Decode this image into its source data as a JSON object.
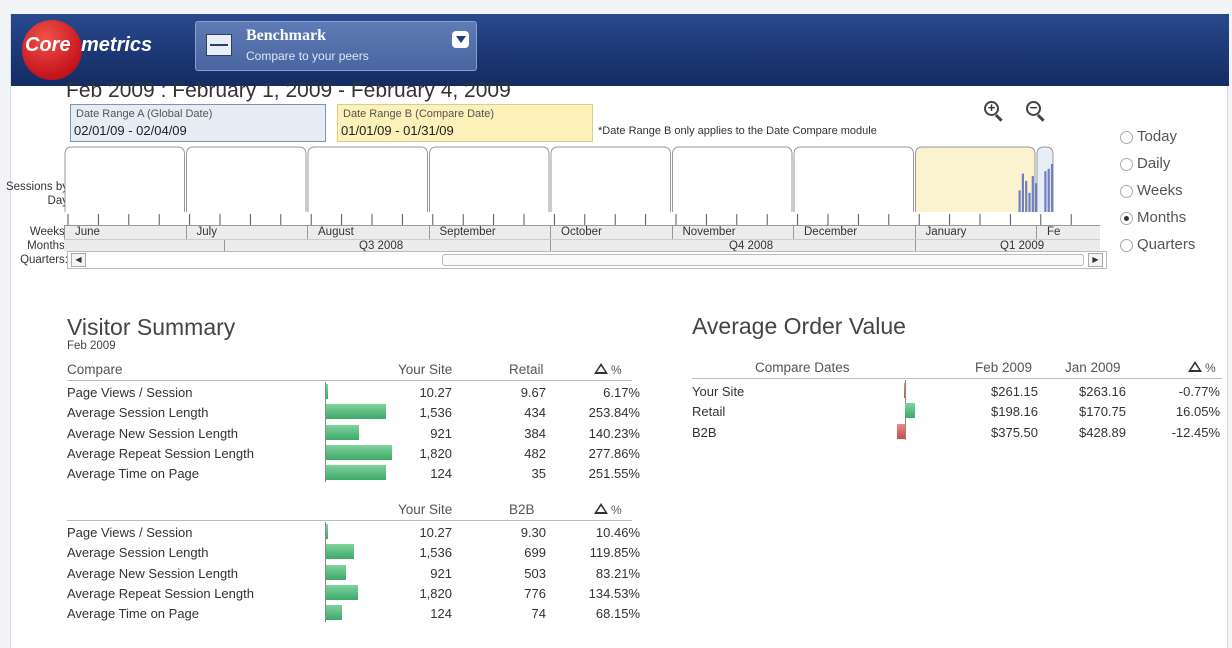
{
  "brand": {
    "core": "Core",
    "metrics": "metrics"
  },
  "report": {
    "title": "Benchmark",
    "subtitle": "Compare to your peers"
  },
  "date_header": "Feb 2009 : February 1, 2009 - February 4, 2009",
  "range_a": {
    "label": "Date Range A (Global Date)",
    "value": "02/01/09 - 02/04/09"
  },
  "range_b": {
    "label": "Date Range B (Compare Date)",
    "value": "01/01/09 - 01/31/09"
  },
  "range_note": "*Date Range B only applies to the Date Compare module",
  "granularity": {
    "options": [
      "Today",
      "Daily",
      "Weeks",
      "Months",
      "Quarters"
    ],
    "selected": "Months"
  },
  "timeline": {
    "row_labels": {
      "sessions": "Sessions by Day",
      "weeks": "Weeks:",
      "months": "Months:",
      "quarters": "Quarters:"
    },
    "months": [
      "June",
      "July",
      "August",
      "September",
      "October",
      "November",
      "December",
      "January",
      "Fe"
    ],
    "quarters": [
      "Q3 2008",
      "Q4 2008",
      "Q1 2009"
    ],
    "sessions_spark": [
      0.45,
      0.8,
      0.65,
      0.4,
      0.75,
      0.6,
      0.85,
      0.9,
      1.0
    ]
  },
  "visitor_summary": {
    "title": "Visitor Summary",
    "period": "Feb 2009",
    "delta_unit": "%",
    "table1": {
      "headers": [
        "Compare",
        "Your Site",
        "Retail"
      ],
      "rows": [
        {
          "metric": "Page Views / Session",
          "your_site": "10.27",
          "peer": "9.67",
          "delta": "6.17%",
          "bar": 6.17
        },
        {
          "metric": "Average Session Length",
          "your_site": "1,536",
          "peer": "434",
          "delta": "253.84%",
          "bar": 253.84
        },
        {
          "metric": "Average New Session Length",
          "your_site": "921",
          "peer": "384",
          "delta": "140.23%",
          "bar": 140.23
        },
        {
          "metric": "Average Repeat Session Length",
          "your_site": "1,820",
          "peer": "482",
          "delta": "277.86%",
          "bar": 277.86
        },
        {
          "metric": "Average Time on Page",
          "your_site": "124",
          "peer": "35",
          "delta": "251.55%",
          "bar": 251.55
        }
      ]
    },
    "table2": {
      "headers": [
        "",
        "Your Site",
        "B2B"
      ],
      "rows": [
        {
          "metric": "Page Views / Session",
          "your_site": "10.27",
          "peer": "9.30",
          "delta": "10.46%",
          "bar": 10.46
        },
        {
          "metric": "Average Session Length",
          "your_site": "1,536",
          "peer": "699",
          "delta": "119.85%",
          "bar": 119.85
        },
        {
          "metric": "Average New Session Length",
          "your_site": "921",
          "peer": "503",
          "delta": "83.21%",
          "bar": 83.21
        },
        {
          "metric": "Average Repeat Session Length",
          "your_site": "1,820",
          "peer": "776",
          "delta": "134.53%",
          "bar": 134.53
        },
        {
          "metric": "Average Time on Page",
          "your_site": "124",
          "peer": "74",
          "delta": "68.15%",
          "bar": 68.15
        }
      ]
    }
  },
  "aov": {
    "title": "Average Order Value",
    "headers": [
      "Compare Dates",
      "Feb 2009",
      "Jan 2009"
    ],
    "delta_unit": "%",
    "rows": [
      {
        "name": "Your Site",
        "feb": "$261.15",
        "jan": "$263.16",
        "delta": "-0.77%",
        "bar": -0.77
      },
      {
        "name": "Retail",
        "feb": "$198.16",
        "jan": "$170.75",
        "delta": "16.05%",
        "bar": 16.05
      },
      {
        "name": "B2B",
        "feb": "$375.50",
        "jan": "$428.89",
        "delta": "-12.45%",
        "bar": -12.45
      }
    ]
  },
  "colors": {
    "header_blue": "#1e3a78",
    "positive_bar": "#3ea86a",
    "negative_bar": "#d9585a",
    "range_a_bg": "#e6ecf3",
    "range_b_bg": "#fcf1b8",
    "spark": "#6f80c0"
  }
}
